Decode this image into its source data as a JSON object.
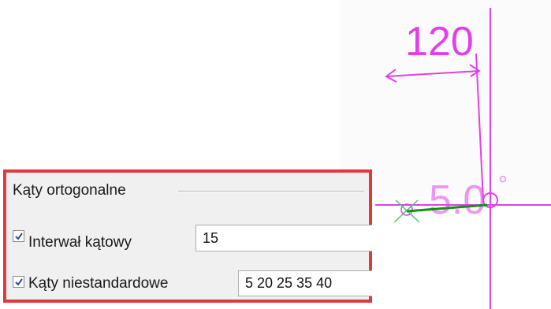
{
  "drawing": {
    "dimension_label": "120",
    "angle_label": "5.0",
    "degree_symbol": "°",
    "colors": {
      "dimension": "#e040e8",
      "marker": "#44cc66",
      "segment": "#1e8a1e",
      "panel_highlight": "#e0393b"
    }
  },
  "settings_panel": {
    "group_title": "Kąty ortogonalne",
    "angle_interval": {
      "label": "Interwał kątowy",
      "checked": true,
      "value": "15"
    },
    "custom_angles": {
      "label": "Kąty niestandardowe",
      "checked": true,
      "value": "5 20 25 35 40"
    }
  }
}
